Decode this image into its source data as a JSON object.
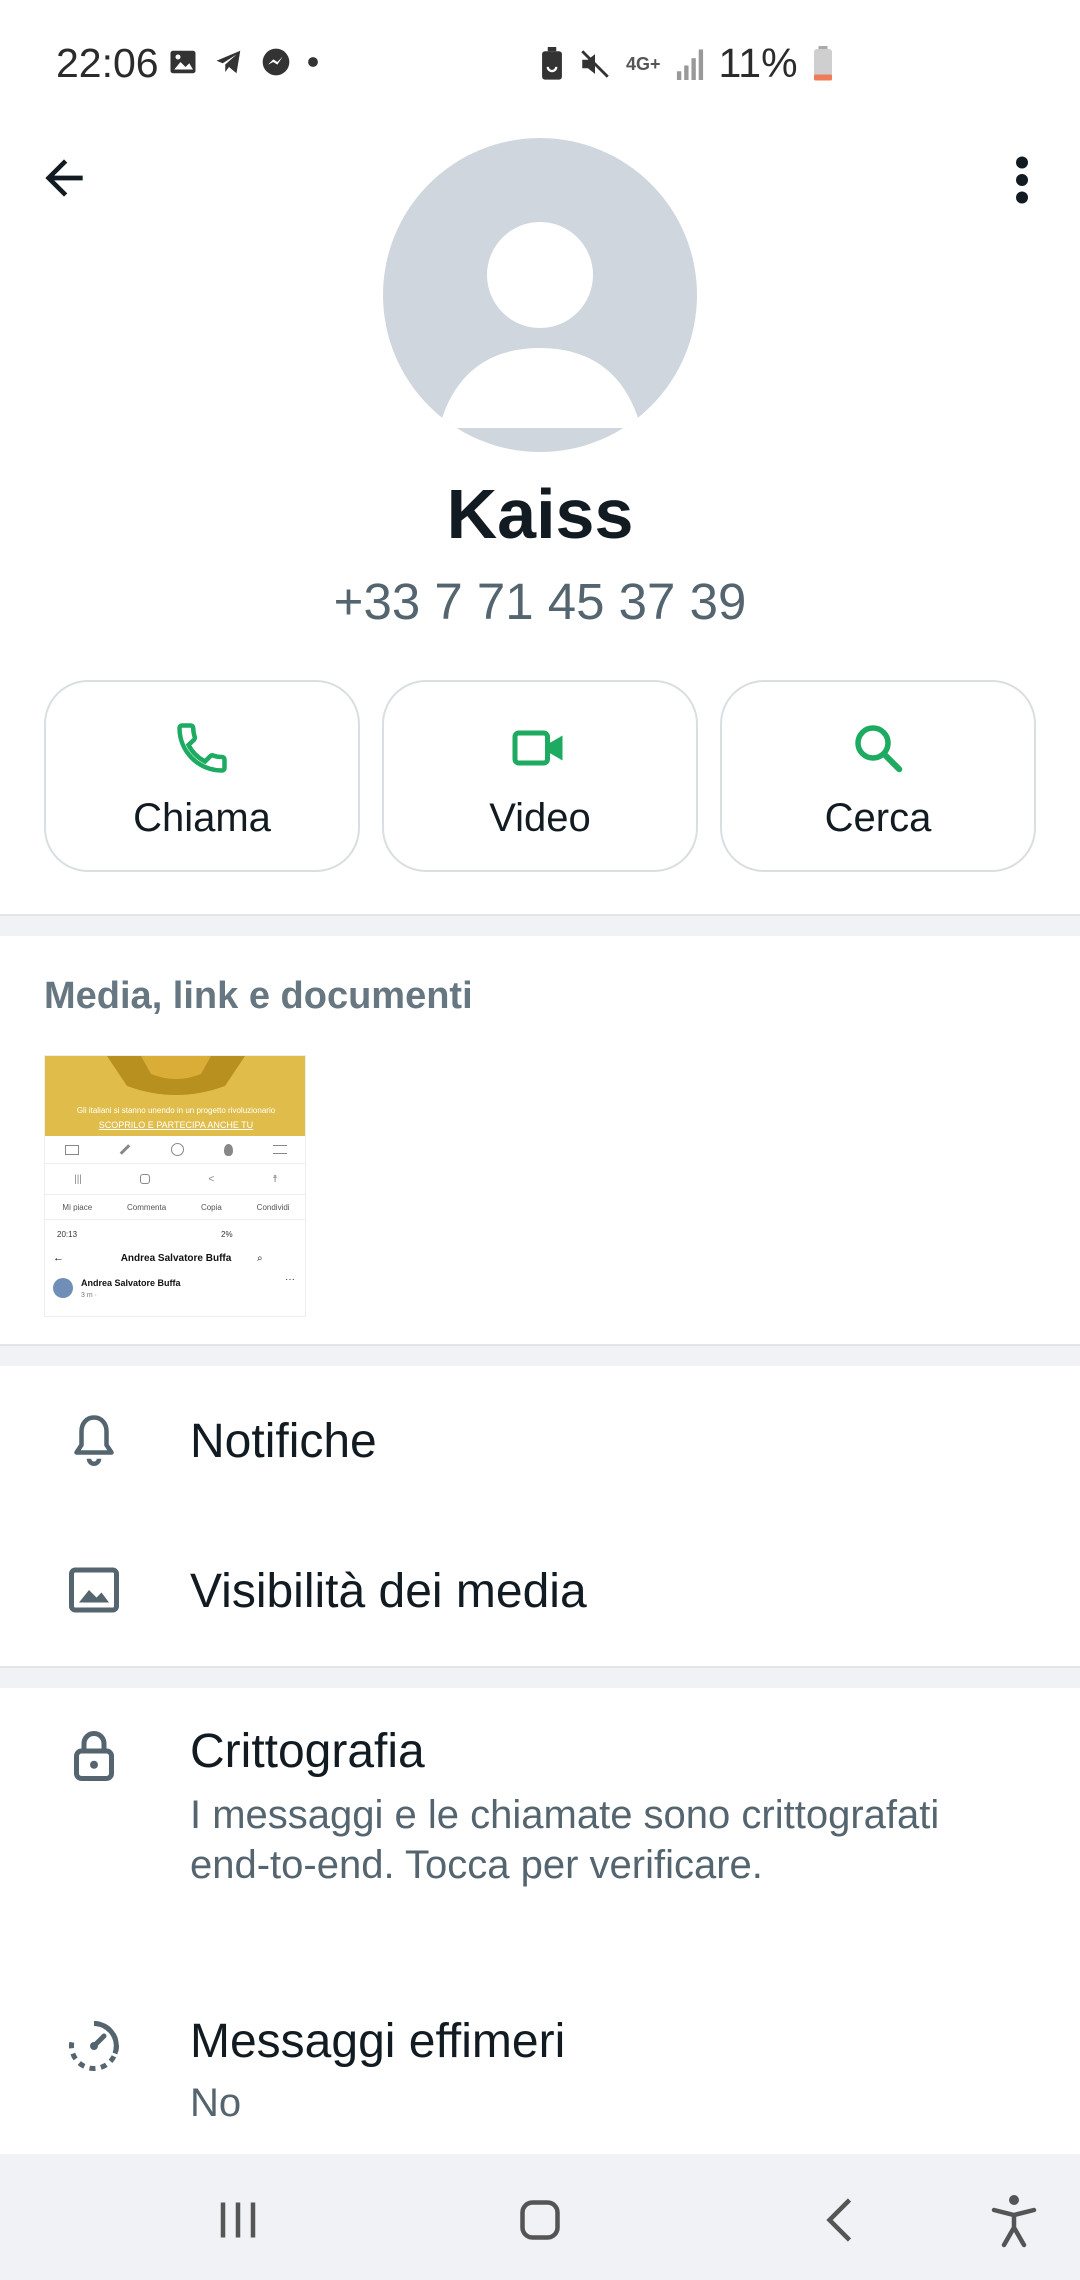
{
  "status_bar": {
    "time": "22:06",
    "network": "4G+",
    "battery": "11%",
    "battery_level": 0.11,
    "left_icons": [
      "gallery-icon",
      "telegram-icon",
      "messenger-icon",
      "dot-icon"
    ],
    "right_icons": [
      "battery-saver-icon",
      "mute-icon",
      "network-icon",
      "signal-icon",
      "battery-icon"
    ]
  },
  "contact": {
    "name": "Kaiss",
    "phone": "+33 7 71 45 37 39"
  },
  "actions": [
    {
      "label": "Chiama",
      "icon": "phone-icon"
    },
    {
      "label": "Video",
      "icon": "video-icon"
    },
    {
      "label": "Cerca",
      "icon": "search-icon"
    }
  ],
  "media": {
    "title": "Media, link e documenti",
    "thumbnail": {
      "banner_line1": "Gli italiani si stanno unendo in un progetto rivoluzionario",
      "banner_line2": "SCOPRILO E PARTECIPA ANCHE TU",
      "actions": [
        "Mi piace",
        "Commenta",
        "Copia",
        "Condividi"
      ],
      "status_time": "20:13",
      "status_battery": "2%",
      "header_name": "Andrea Salvatore Buffa",
      "post_author": "Andrea Salvatore Buffa",
      "post_meta": "3 m ·"
    }
  },
  "settings": [
    {
      "title": "Notifiche",
      "icon": "bell-icon"
    },
    {
      "title": "Visibilità dei media",
      "icon": "image-icon"
    }
  ],
  "security": [
    {
      "title": "Crittografia",
      "subtitle": "I messaggi e le chiamate sono crittografati end-to-end. Tocca per verificare.",
      "icon": "lock-icon"
    },
    {
      "title": "Messaggi effimeri",
      "subtitle": "No",
      "icon": "timer-icon"
    }
  ],
  "colors": {
    "accent": "#1daa61",
    "text_primary": "#111b21",
    "text_secondary": "#54656f",
    "avatar_bg": "#cfd6dd"
  }
}
